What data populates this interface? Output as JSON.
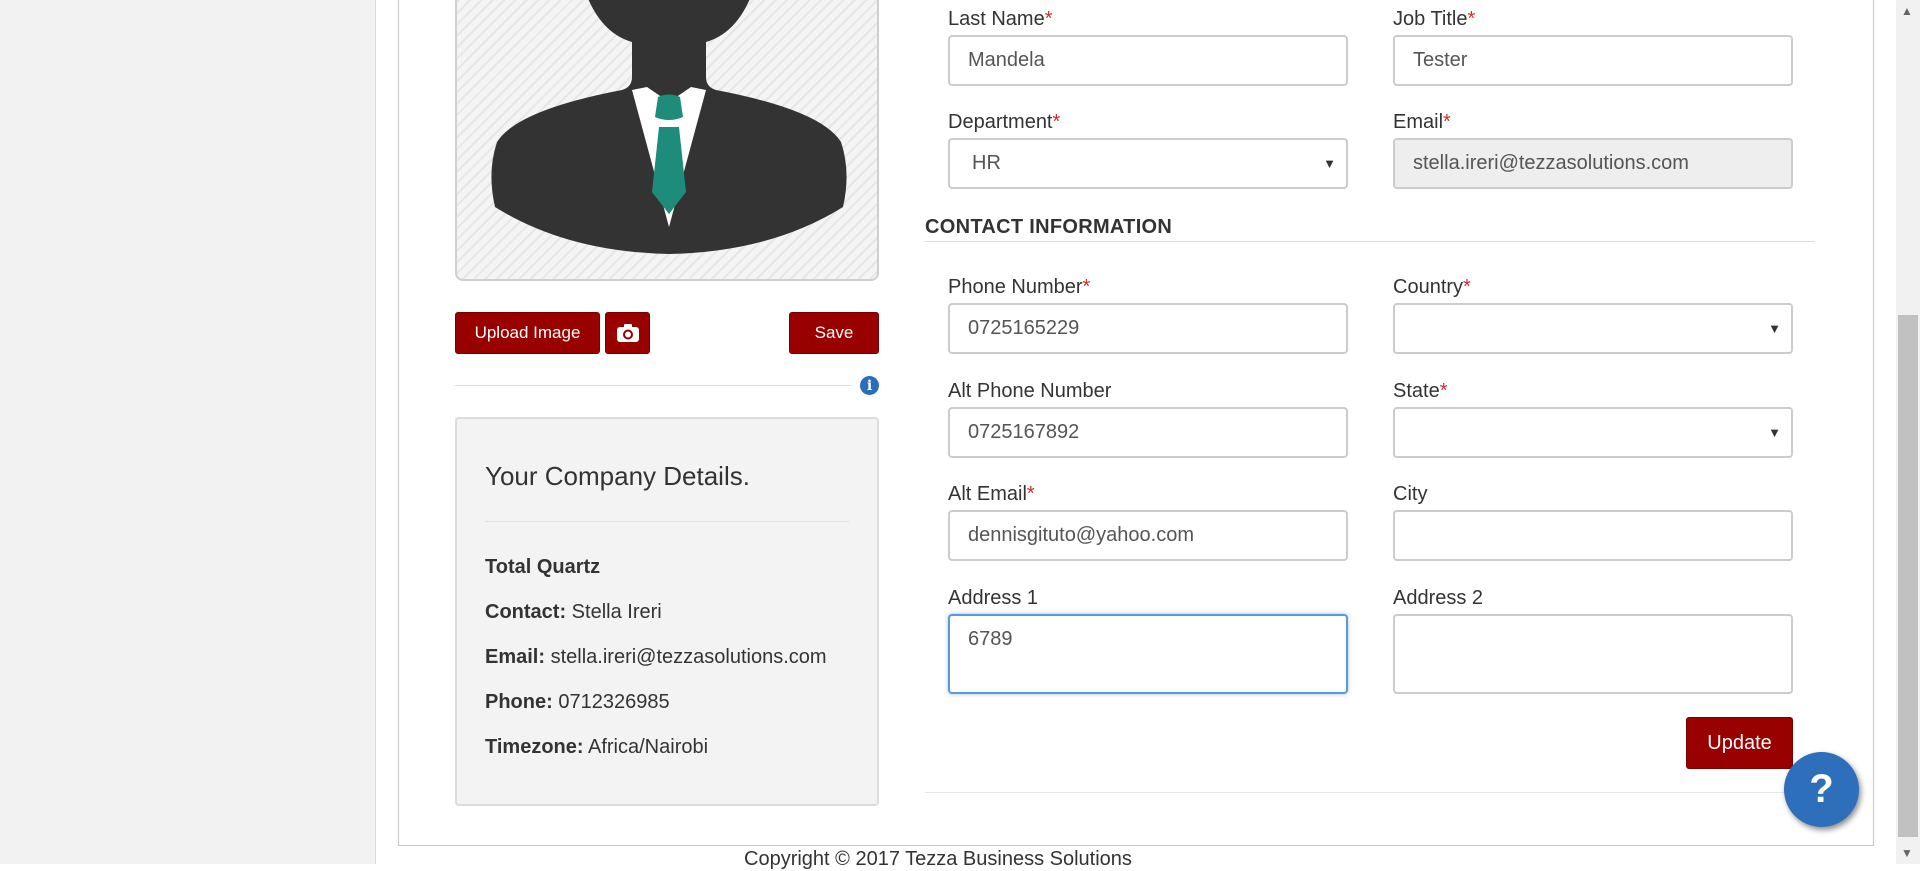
{
  "profile": {
    "upload_label": "Upload Image",
    "camera_icon": "camera-icon",
    "save_label": "Save",
    "info_icon": "info-icon",
    "info_glyph": "i"
  },
  "company": {
    "heading": "Your Company Details.",
    "name": "Total Quartz",
    "contact_label": "Contact:",
    "contact_value": "Stella Ireri",
    "email_label": "Email:",
    "email_value": "stella.ireri@tezzasolutions.com",
    "phone_label": "Phone:",
    "phone_value": "0712326985",
    "timezone_label": "Timezone:",
    "timezone_value": "Africa/Nairobi"
  },
  "form": {
    "last_name": {
      "label": "Last Name",
      "value": "Mandela"
    },
    "job_title": {
      "label": "Job Title",
      "value": "Tester"
    },
    "department": {
      "label": "Department",
      "value": "HR"
    },
    "email": {
      "label": "Email",
      "value": "stella.ireri@tezzasolutions.com"
    },
    "required_mark": "*",
    "contact_section": "CONTACT INFORMATION",
    "phone": {
      "label": "Phone Number",
      "value": "0725165229"
    },
    "country": {
      "label": "Country",
      "value": ""
    },
    "alt_phone": {
      "label": "Alt Phone Number",
      "value": "0725167892"
    },
    "state": {
      "label": "State",
      "value": ""
    },
    "alt_email": {
      "label": "Alt Email",
      "value": "dennisgituto@yahoo.com"
    },
    "city": {
      "label": "City",
      "value": ""
    },
    "address1": {
      "label": "Address 1",
      "value": "6789"
    },
    "address2": {
      "label": "Address 2",
      "value": ""
    },
    "update_label": "Update",
    "dropdown_arrow": "▼"
  },
  "help": {
    "glyph": "?"
  },
  "footer": {
    "text": "Copyright © 2017 Tezza Business Solutions"
  },
  "colors": {
    "primary": "#990000",
    "help": "#2d6fba",
    "focus": "#5b9bd5"
  }
}
